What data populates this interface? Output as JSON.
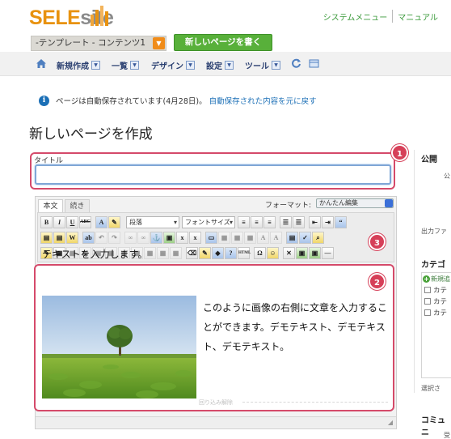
{
  "header": {
    "logo_sele": "SELE",
    "logo_site": "site",
    "system_menu": "システムメニュー",
    "manual": "マニュアル",
    "template_select": "-テンプレート - コンテンツ1",
    "new_page_button": "新しいページを書く"
  },
  "menu": {
    "new": "新規作成",
    "list": "一覧",
    "design": "デザイン",
    "settings": "設定",
    "tools": "ツール"
  },
  "notice": {
    "text": "ページは自動保存されています(4月28日)。",
    "restore_link": "自動保存された内容を元に戻す"
  },
  "page_title": "新しいページを作成",
  "title_field": {
    "label": "タイトル",
    "value": ""
  },
  "editor": {
    "tab_main": "本文",
    "tab_more": "続き",
    "format_label": "フォーマット:",
    "format_value": "かんたん編集",
    "paragraph_select": "段落",
    "font_size_select": "フォントサイズ",
    "content_heading": "テキストを入力します。",
    "side_text": "このように画像の右側に文章を入力することができます。デモテキスト、デモテキスト、デモテキスト。",
    "float_clear": "回り込み解除"
  },
  "badges": [
    "1",
    "2",
    "3"
  ],
  "sidebar": {
    "publish": "公開",
    "publish_sub": "公",
    "output": "出力ファ",
    "category": "カテゴリ",
    "add_new": "新規追",
    "categories": [
      "カテ",
      "カテ",
      "カテ"
    ],
    "selected": "選択さ",
    "community": "コミュニ",
    "bottom_small": "受"
  },
  "colors": {
    "accent_orange": "#e8920f",
    "green_button": "#58b03a",
    "highlight_red": "#d54a6a",
    "link_blue": "#1b6fb6"
  }
}
